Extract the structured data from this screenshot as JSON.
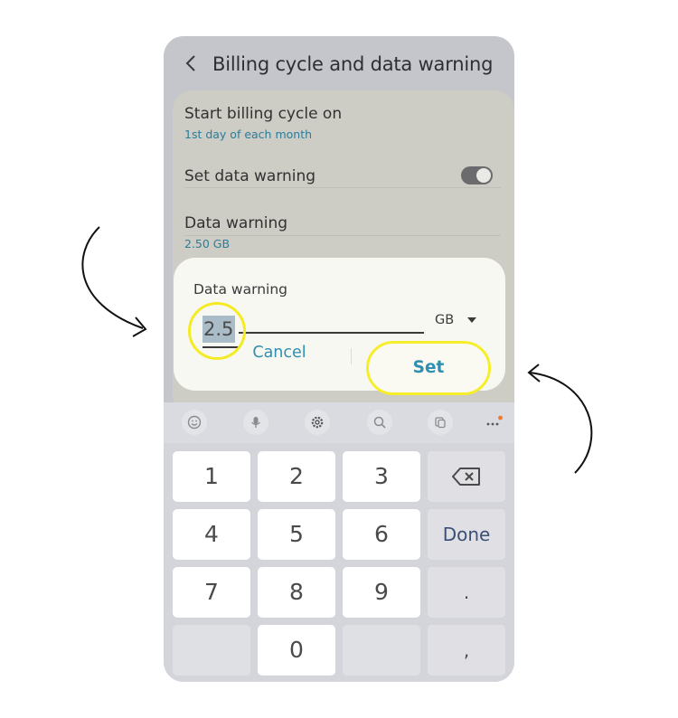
{
  "header": {
    "title": "Billing cycle and data warning"
  },
  "settings": {
    "billing_title": "Start billing cycle on",
    "billing_value": "1st day of each month",
    "set_warning_title": "Set data warning",
    "set_warning_on": true,
    "data_warning_title": "Data warning",
    "data_warning_value": "2.50 GB"
  },
  "dialog": {
    "title": "Data warning",
    "value": "2.5",
    "unit": "GB",
    "cancel_label": "Cancel",
    "set_label": "Set"
  },
  "keyboard": {
    "toolbar_icons": [
      "emoji-icon",
      "mic-icon",
      "settings-icon",
      "search-icon",
      "clipboard-icon",
      "more-icon"
    ],
    "keys": {
      "k1": "1",
      "k2": "2",
      "k3": "3",
      "k4": "4",
      "k5": "5",
      "k6": "6",
      "k7": "7",
      "k8": "8",
      "k9": "9",
      "k0": "0",
      "done": "Done",
      "period": ".",
      "comma": ","
    }
  },
  "colors": {
    "accent": "#2f8fb0",
    "highlight": "#f4eb24",
    "phone_bg": "#c5c6cb",
    "keyboard_bg": "#d4d5da"
  }
}
